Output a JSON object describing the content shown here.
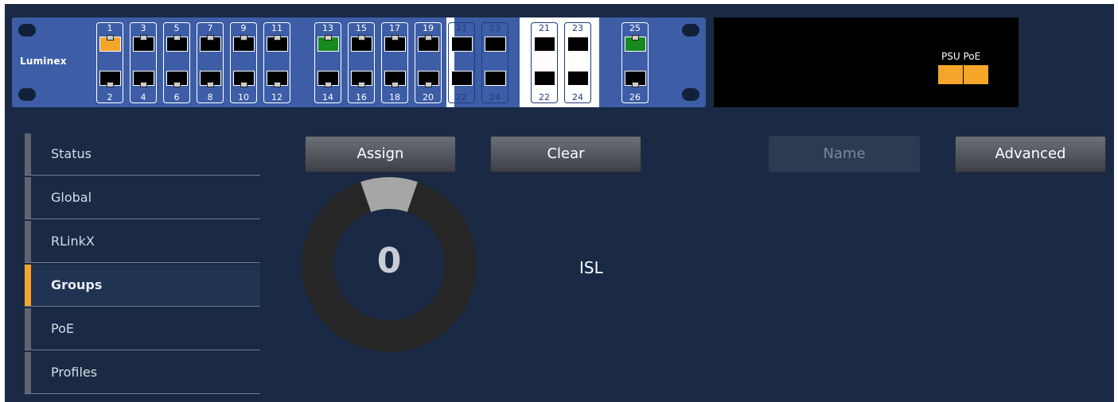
{
  "brand": "Luminex",
  "ports": {
    "top_group1": [
      {
        "n": "1",
        "state": "orange"
      },
      {
        "n": "3",
        "state": "off"
      },
      {
        "n": "5",
        "state": "off"
      },
      {
        "n": "7",
        "state": "off"
      },
      {
        "n": "9",
        "state": "off"
      },
      {
        "n": "11",
        "state": "off"
      }
    ],
    "bottom_group1": [
      {
        "n": "2",
        "state": "off"
      },
      {
        "n": "4",
        "state": "off"
      },
      {
        "n": "6",
        "state": "off"
      },
      {
        "n": "8",
        "state": "off"
      },
      {
        "n": "10",
        "state": "off"
      },
      {
        "n": "12",
        "state": "off"
      }
    ],
    "top_group2": [
      {
        "n": "13",
        "state": "green"
      },
      {
        "n": "15",
        "state": "off"
      },
      {
        "n": "17",
        "state": "off"
      },
      {
        "n": "19",
        "state": "off"
      },
      {
        "n": "21",
        "state": "off"
      },
      {
        "n": "23",
        "state": "off"
      }
    ],
    "bottom_group2": [
      {
        "n": "14",
        "state": "off"
      },
      {
        "n": "16",
        "state": "off"
      },
      {
        "n": "18",
        "state": "off"
      },
      {
        "n": "20",
        "state": "off"
      },
      {
        "n": "22",
        "state": "off"
      },
      {
        "n": "24",
        "state": "off"
      }
    ],
    "sfp_top": [
      {
        "n": "21",
        "state": "off"
      },
      {
        "n": "23",
        "state": "off"
      }
    ],
    "sfp_bottom": [
      {
        "n": "22",
        "state": "off"
      },
      {
        "n": "24",
        "state": "off"
      }
    ],
    "uplink_top": {
      "n": "25",
      "state": "green"
    },
    "uplink_bottom": {
      "n": "26",
      "state": "off"
    }
  },
  "status_panel": {
    "psu_label": "PSU",
    "poe_label": "PoE",
    "psu_color": "#f5a52a",
    "poe_color": "#f5a52a"
  },
  "sidebar": {
    "items": [
      {
        "label": "Status",
        "active": false
      },
      {
        "label": "Global",
        "active": false
      },
      {
        "label": "RLinkX",
        "active": false
      },
      {
        "label": "Groups",
        "active": true
      },
      {
        "label": "PoE",
        "active": false
      },
      {
        "label": "Profiles",
        "active": false
      }
    ]
  },
  "toolbar": {
    "assign_label": "Assign",
    "clear_label": "Clear",
    "name_label": "Name",
    "advanced_label": "Advanced"
  },
  "gauge": {
    "value": "0",
    "segment_color": "#a6a6a6",
    "ring_color": "#262626"
  },
  "group_label": "ISL",
  "colors": {
    "accent": "#f5a52a",
    "panel": "#3d5ea6",
    "background": "#1a2a45",
    "link_green": "#17891f"
  }
}
